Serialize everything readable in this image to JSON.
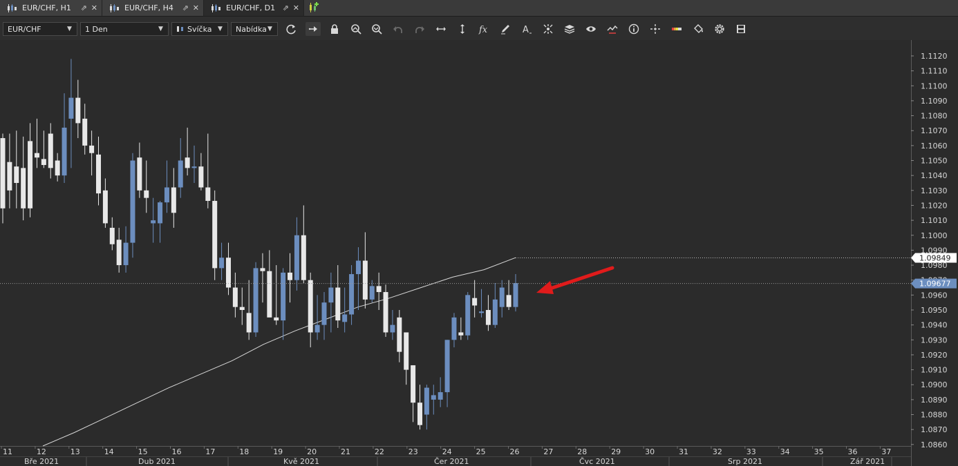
{
  "tabs": [
    {
      "label": "EUR/CHF, H1",
      "active": false
    },
    {
      "label": "EUR/CHF, H4",
      "active": false
    },
    {
      "label": "EUR/CHF, D1",
      "active": true
    }
  ],
  "toolbar": {
    "symbol": "EUR/CHF",
    "period": "1 Den",
    "chart_type": "Svíčka",
    "price_type": "Nabídka",
    "icons": [
      "refresh-icon",
      "auto-scroll-icon",
      "lock-icon",
      "zoom-in-icon",
      "zoom-out-icon",
      "undo-icon",
      "redo-icon",
      "horizontal-scale-icon",
      "vertical-scale-icon",
      "indicators-fx-icon",
      "pencil-icon",
      "text-icon",
      "crosshair-icon",
      "layers-icon",
      "eye-icon",
      "trade-icon",
      "info-icon",
      "cursor-icon",
      "color-palette-icon",
      "fill-icon",
      "settings-icon",
      "save-icon"
    ]
  },
  "chart_data": {
    "type": "candlestick",
    "symbol": "EUR/CHF",
    "timeframe": "D1",
    "ylim": [
      1.0859,
      1.1126
    ],
    "y_ticks": [
      "1.0860",
      "1.0870",
      "1.0880",
      "1.0890",
      "1.0900",
      "1.0910",
      "1.0920",
      "1.0930",
      "1.0940",
      "1.0950",
      "1.0960",
      "1.0970",
      "1.0980",
      "1.0990",
      "1.1000",
      "1.1010",
      "1.1020",
      "1.1030",
      "1.1040",
      "1.1050",
      "1.1060",
      "1.1070",
      "1.1080",
      "1.1090",
      "1.1100",
      "1.1110",
      "1.1120"
    ],
    "week_labels": [
      "11",
      "12",
      "13",
      "14",
      "15",
      "16",
      "17",
      "18",
      "19",
      "20",
      "21",
      "22",
      "23",
      "24",
      "25",
      "26",
      "27",
      "28",
      "29",
      "30",
      "31",
      "32",
      "33",
      "34",
      "35",
      "36",
      "37"
    ],
    "month_labels": [
      "Bře 2021",
      "Dub 2021",
      "Kvě 2021",
      "Čer 2021",
      "Čvc 2021",
      "Srp 2021",
      "Zář 2021"
    ],
    "line_price": "1.09849",
    "last_price": "1.09677",
    "colors": {
      "bull": "#6c8ebf",
      "bear": "#e8e8e8",
      "ma": "#d8d8d8",
      "arrow": "#e01b1b",
      "bg": "#2b2b2b"
    },
    "ma_series": [
      [
        1.0859,
        1.0859
      ],
      [
        1.087,
        1.0868
      ],
      [
        1.088,
        1.0878
      ],
      [
        1.089,
        1.0888
      ],
      [
        1.0898,
        1.0898
      ],
      [
        1.0908,
        1.0907
      ],
      [
        1.0918,
        1.0916
      ],
      [
        1.0928,
        1.0927
      ],
      [
        1.0936,
        1.0936
      ],
      [
        1.0944,
        1.0944
      ],
      [
        1.0952,
        1.0952
      ],
      [
        1.0958,
        1.0958
      ],
      [
        1.0966,
        1.0965
      ],
      [
        1.0972,
        1.0972
      ],
      [
        1.0978,
        1.0977
      ],
      [
        1.0985,
        1.0985
      ]
    ],
    "candles": [
      [
        1.1065,
        1.1068,
        1.1008,
        1.1018
      ],
      [
        1.1049,
        1.1068,
        1.1018,
        1.103
      ],
      [
        1.1046,
        1.107,
        1.1018,
        1.1035
      ],
      [
        1.1045,
        1.1066,
        1.101,
        1.1018
      ],
      [
        1.1063,
        1.1075,
        1.1012,
        1.1018
      ],
      [
        1.1055,
        1.1078,
        1.1045,
        1.1052
      ],
      [
        1.1051,
        1.107,
        1.1045,
        1.1047
      ],
      [
        1.1068,
        1.1075,
        1.1038,
        1.1045
      ],
      [
        1.105,
        1.1055,
        1.1036,
        1.104
      ],
      [
        1.104,
        1.1095,
        1.1035,
        1.1072
      ],
      [
        1.1078,
        1.1118,
        1.1045,
        1.1092
      ],
      [
        1.1092,
        1.1104,
        1.1065,
        1.1075
      ],
      [
        1.1078,
        1.1088,
        1.1054,
        1.106
      ],
      [
        1.106,
        1.107,
        1.104,
        1.1055
      ],
      [
        1.1054,
        1.1066,
        1.102,
        1.1028
      ],
      [
        1.103,
        1.1038,
        1.1005,
        1.1008
      ],
      [
        1.1005,
        1.1012,
        1.099,
        1.0994
      ],
      [
        1.0997,
        1.1005,
        1.0975,
        1.098
      ],
      [
        1.098,
        1.1006,
        1.0975,
        1.0995
      ],
      [
        1.0995,
        1.1055,
        1.0985,
        1.105
      ],
      [
        1.1052,
        1.1062,
        1.1025,
        1.103
      ],
      [
        1.103,
        1.105,
        1.1015,
        1.1025
      ],
      [
        1.1008,
        1.1025,
        1.0995,
        1.101
      ],
      [
        1.1008,
        1.1023,
        1.0995,
        1.1022
      ],
      [
        1.1022,
        1.105,
        1.1015,
        1.1032
      ],
      [
        1.1032,
        1.1045,
        1.1005,
        1.1015
      ],
      [
        1.1032,
        1.1065,
        1.1025,
        1.105
      ],
      [
        1.1052,
        1.1072,
        1.104,
        1.1045
      ],
      [
        1.1045,
        1.106,
        1.1035,
        1.1046
      ],
      [
        1.1046,
        1.1055,
        1.103,
        1.1032
      ],
      [
        1.1032,
        1.1068,
        1.1018,
        1.1023
      ],
      [
        1.1023,
        1.103,
        1.097,
        1.0978
      ],
      [
        1.0978,
        1.0995,
        1.097,
        1.0985
      ],
      [
        1.0985,
        1.0995,
        1.096,
        1.0965
      ],
      [
        1.0965,
        1.0975,
        1.0945,
        1.0952
      ],
      [
        1.0952,
        1.0965,
        1.094,
        1.095
      ],
      [
        1.0948,
        1.097,
        1.093,
        1.0935
      ],
      [
        1.0935,
        1.0982,
        1.0932,
        1.0978
      ],
      [
        1.0978,
        1.0988,
        1.0955,
        1.0976
      ],
      [
        1.0976,
        1.099,
        1.0955,
        1.0945
      ],
      [
        1.0945,
        1.098,
        1.094,
        1.0943
      ],
      [
        1.0943,
        1.0978,
        1.093,
        1.0975
      ],
      [
        1.0975,
        1.0988,
        1.0955,
        1.097
      ],
      [
        1.097,
        1.1012,
        1.0963,
        1.1
      ],
      [
        1.1,
        1.102,
        1.0968,
        1.097
      ],
      [
        1.097,
        1.0975,
        1.0925,
        1.0935
      ],
      [
        1.0935,
        1.096,
        1.093,
        1.094
      ],
      [
        1.094,
        1.0962,
        1.093,
        1.0955
      ],
      [
        1.0955,
        1.0975,
        1.0935,
        1.0965
      ],
      [
        1.0965,
        1.098,
        1.0938,
        1.0943
      ],
      [
        1.0942,
        1.0965,
        1.0935,
        1.0947
      ],
      [
        1.0947,
        1.098,
        1.094,
        1.0974
      ],
      [
        1.0974,
        1.0992,
        1.095,
        1.0983
      ],
      [
        1.0983,
        1.1002,
        1.0951,
        1.0957
      ],
      [
        1.0957,
        1.097,
        1.0955,
        1.0966
      ],
      [
        1.0966,
        1.0975,
        1.095,
        1.0962
      ],
      [
        1.0962,
        1.0967,
        1.0932,
        1.0935
      ],
      [
        1.0935,
        1.095,
        1.093,
        1.094
      ],
      [
        1.0945,
        1.095,
        1.0915,
        1.0922
      ],
      [
        1.0935,
        1.0935,
        1.09,
        1.091
      ],
      [
        1.0913,
        1.0913,
        1.0875,
        1.0888
      ],
      [
        1.0888,
        1.09,
        1.087,
        1.0873
      ],
      [
        1.088,
        1.09,
        1.087,
        1.0898
      ],
      [
        1.089,
        1.09,
        1.088,
        1.0893
      ],
      [
        1.089,
        1.0905,
        1.0885,
        1.0895
      ],
      [
        1.0895,
        1.093,
        1.0885,
        1.093
      ],
      [
        1.093,
        1.0948,
        1.0925,
        1.0945
      ],
      [
        1.0935,
        1.0945,
        1.093,
        1.0933
      ],
      [
        1.0933,
        1.0962,
        1.093,
        1.096
      ],
      [
        1.0958,
        1.097,
        1.0945,
        1.0953
      ],
      [
        1.0948,
        1.0964,
        1.0945,
        1.0949
      ],
      [
        1.095,
        1.096,
        1.0936,
        1.094
      ],
      [
        1.094,
        1.0968,
        1.0938,
        1.0957
      ],
      [
        1.0952,
        1.097,
        1.0945,
        1.0965
      ],
      [
        1.096,
        1.097,
        1.095,
        1.0952
      ],
      [
        1.0952,
        1.0974,
        1.0949,
        1.0968
      ]
    ]
  }
}
